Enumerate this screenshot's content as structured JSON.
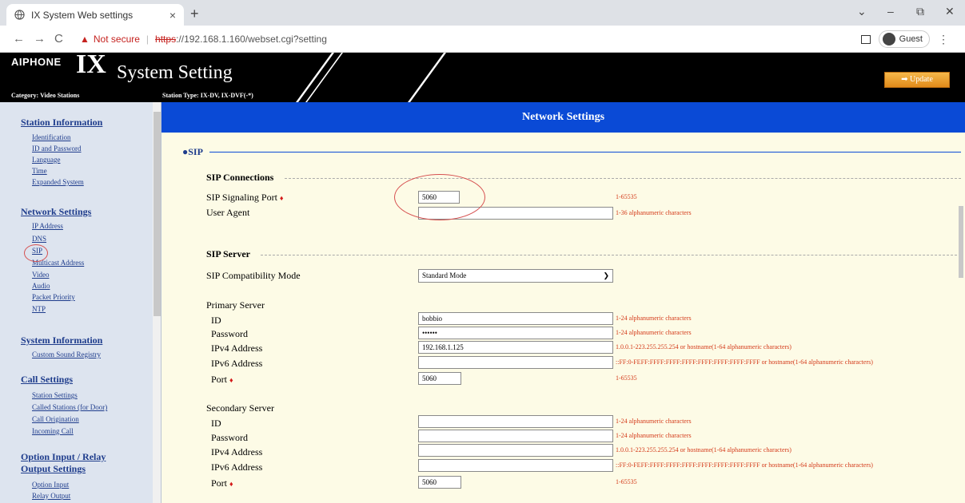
{
  "browser": {
    "tab_title": "IX System Web settings",
    "tab_close": "×",
    "new_tab": "+",
    "not_secure": "Not secure",
    "url_scheme": "https",
    "url_rest": "://192.168.1.160/webset.cgi?setting",
    "profile_label": "Guest",
    "window_controls": [
      "⌄",
      "–",
      "⧉",
      "✕"
    ],
    "nav": [
      "←",
      "→",
      "C"
    ]
  },
  "header": {
    "brand": "AIPHONE",
    "ix": "IX",
    "system_setting": "System Setting",
    "category": "Category:  Video Stations",
    "station_type": "Station Type:  IX-DV, IX-DVF(-*)",
    "update_button": "Update"
  },
  "sidebar": {
    "sections": [
      {
        "title": "Station Information",
        "items": [
          "Identification",
          "ID and Password",
          "Language",
          "Time",
          "Expanded System"
        ]
      },
      {
        "title": "Network Settings",
        "items": [
          "IP Address",
          "DNS",
          "SIP",
          "Multicast Address",
          "Video",
          "Audio",
          "Packet Priority",
          "NTP"
        ]
      },
      {
        "title": "System Information",
        "items": [
          "Custom Sound Registry"
        ]
      },
      {
        "title": "Call Settings",
        "items": [
          "Station Settings",
          "Called Stations (for Door)",
          "Call Origination",
          "Incoming Call"
        ]
      },
      {
        "title": "Option Input / Relay",
        "items": []
      },
      {
        "title": "Output Settings",
        "items": [
          "Option Input",
          "Relay Output"
        ]
      }
    ]
  },
  "main": {
    "page_title": "Network Settings",
    "sip_heading": "●SIP",
    "sip_connections": {
      "title": "SIP Connections",
      "signaling_port_label": "SIP Signaling Port",
      "signaling_port_value": "5060",
      "signaling_port_hint": "1-65535",
      "user_agent_label": "User Agent",
      "user_agent_value": "",
      "user_agent_hint": "1-36 alphanumeric characters"
    },
    "sip_server": {
      "title": "SIP Server",
      "compat_label": "SIP Compatibility Mode",
      "compat_value": "Standard Mode",
      "primary": {
        "title": "Primary Server",
        "id_label": "ID",
        "id_value": "bobbio",
        "id_hint": "1-24 alphanumeric characters",
        "pw_label": "Password",
        "pw_value": "••••••",
        "pw_hint": "1-24 alphanumeric characters",
        "ipv4_label": "IPv4 Address",
        "ipv4_value": "192.168.1.125",
        "ipv4_hint": "1.0.0.1-223.255.255.254 or hostname(1-64 alphanumeric characters)",
        "ipv6_label": "IPv6 Address",
        "ipv6_value": "",
        "ipv6_hint": "::FF:0-FEFF:FFFF:FFFF:FFFF:FFFF:FFFF:FFFF:FFFF or hostname(1-64 alphanumeric characters)",
        "port_label": "Port",
        "port_value": "5060",
        "port_hint": "1-65535"
      },
      "secondary": {
        "title": "Secondary Server",
        "id_label": "ID",
        "id_value": "",
        "id_hint": "1-24 alphanumeric characters",
        "pw_label": "Password",
        "pw_value": "",
        "pw_hint": "1-24 alphanumeric characters",
        "ipv4_label": "IPv4 Address",
        "ipv4_value": "",
        "ipv4_hint": "1.0.0.1-223.255.255.254 or hostname(1-64 alphanumeric characters)",
        "ipv6_label": "IPv6 Address",
        "ipv6_value": "",
        "ipv6_hint": "::FF:0-FEFF:FFFF:FFFF:FFFF:FFFF:FFFF:FFFF:FFFF or hostname(1-64 alphanumeric characters)",
        "port_label": "Port",
        "port_value": "5060",
        "port_hint": "1-65535"
      }
    }
  },
  "colors": {
    "title_bar": "#0a4ad6",
    "sidebar_bg": "#dde4ef",
    "main_bg": "#fdfbe6",
    "hint_red": "#d43a1a",
    "annotation_red": "#d65050"
  }
}
